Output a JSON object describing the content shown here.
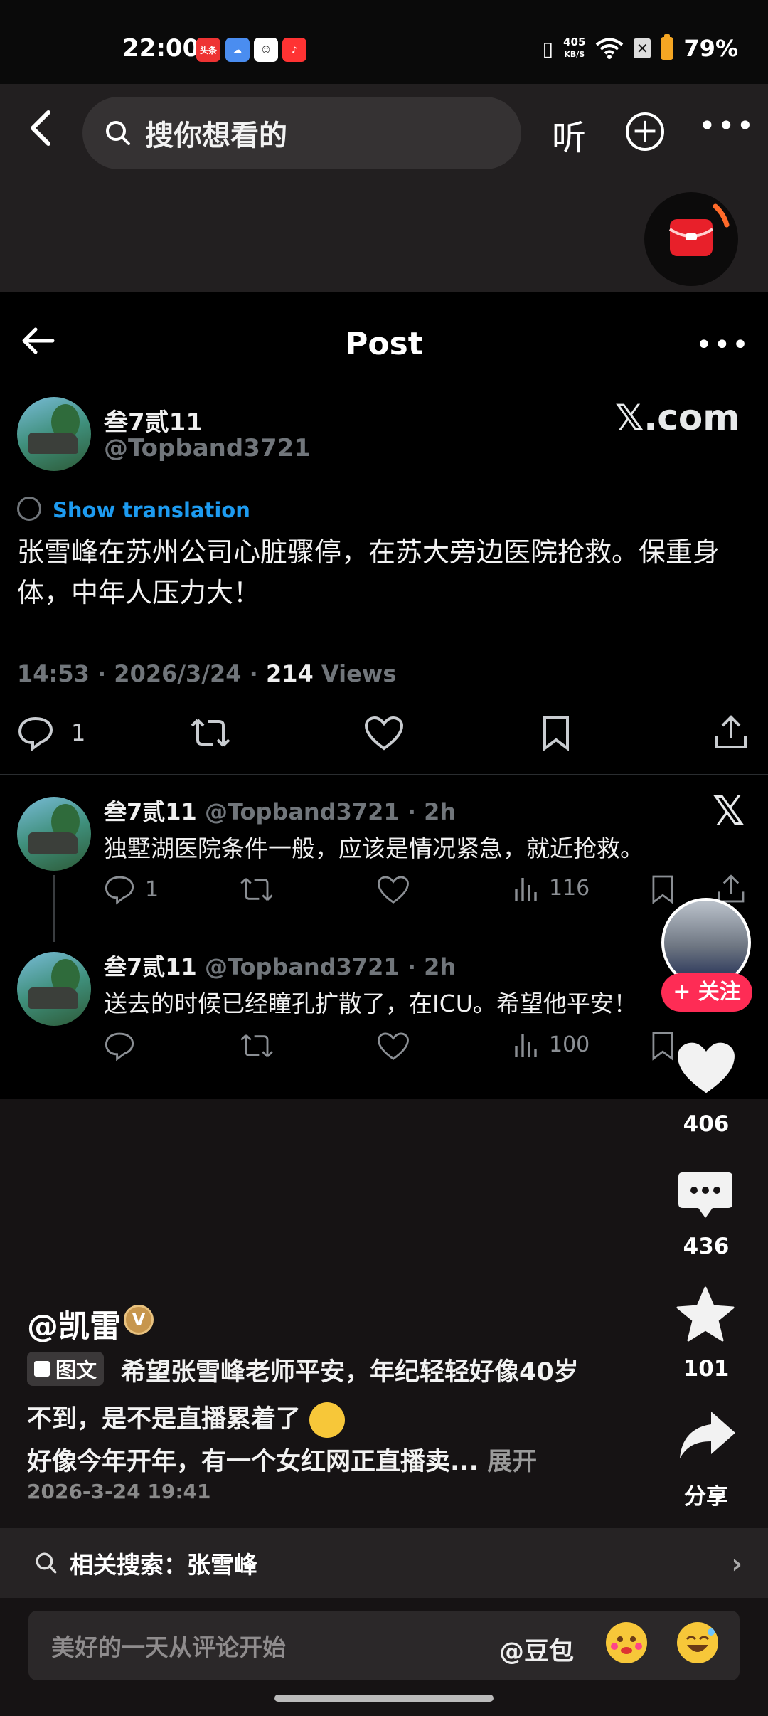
{
  "status_bar": {
    "time": "22:00",
    "apps": [
      "头条",
      "",
      "",
      ""
    ],
    "netspeed_value": "405",
    "netspeed_unit": "KB/S",
    "battery": "79%"
  },
  "top_nav": {
    "search_placeholder": "搜你想看的",
    "listen_label": "听"
  },
  "embedded_post": {
    "header_title": "Post",
    "author_name": "叁7贰11",
    "author_handle": "@Topband3721",
    "watermark": "𝕏.com",
    "show_translation": "Show translation",
    "body": "张雪峰在苏州公司心脏骤停，在苏大旁边医院抢救。保重身体，中年人压力大！",
    "meta_time": "14:53 · 2026/3/24 · ",
    "meta_views_count": "214",
    "meta_views_label": " Views",
    "reply_count": "1",
    "x_logo": "𝕏",
    "replies": [
      {
        "name": "叁7贰11",
        "handle_time": "@Topband3721 · 2h",
        "text": "独墅湖医院条件一般，应该是情况紧急，就近抢救。",
        "reply_count": "1",
        "views": "116"
      },
      {
        "name": "叁7贰11",
        "handle_time": "@Topband3721 · 2h",
        "text": "送去的时候已经瞳孔扩散了，在ICU。希望他平安！",
        "reply_count": "",
        "views": "100"
      }
    ]
  },
  "right_rail": {
    "follow_label": "+ 关注",
    "likes": "406",
    "comments": "436",
    "favorites": "101",
    "share_label": "分享"
  },
  "caption": {
    "author": "@凯雷",
    "verified_badge": "V",
    "type_tag": "图文",
    "line1": "希望张雪峰老师平安，年纪轻轻好像40岁",
    "line2": "不到，是不是直播累着了",
    "line3": "好像今年开年，有一个女红网正直播卖...",
    "expand": "展开",
    "date": "2026-3-24 19:41"
  },
  "related_search": {
    "label": "相关搜索：张雪峰"
  },
  "comment_bar": {
    "placeholder": "美好的一天从评论开始",
    "at_label": "@豆包"
  },
  "colors": {
    "accent_red": "#fe2c55",
    "link_blue": "#1d9bf0",
    "muted_gray": "#71767b"
  },
  "icons": [
    "back-icon",
    "search-icon",
    "add-circle-icon",
    "more-icon",
    "red-packet-icon",
    "reply-icon",
    "repost-icon",
    "like-icon",
    "bookmark-icon",
    "share-icon",
    "views-icon",
    "heart-icon",
    "comment-icon",
    "star-icon",
    "share-arrow-icon",
    "chevron-right-icon",
    "emoji-icon"
  ]
}
